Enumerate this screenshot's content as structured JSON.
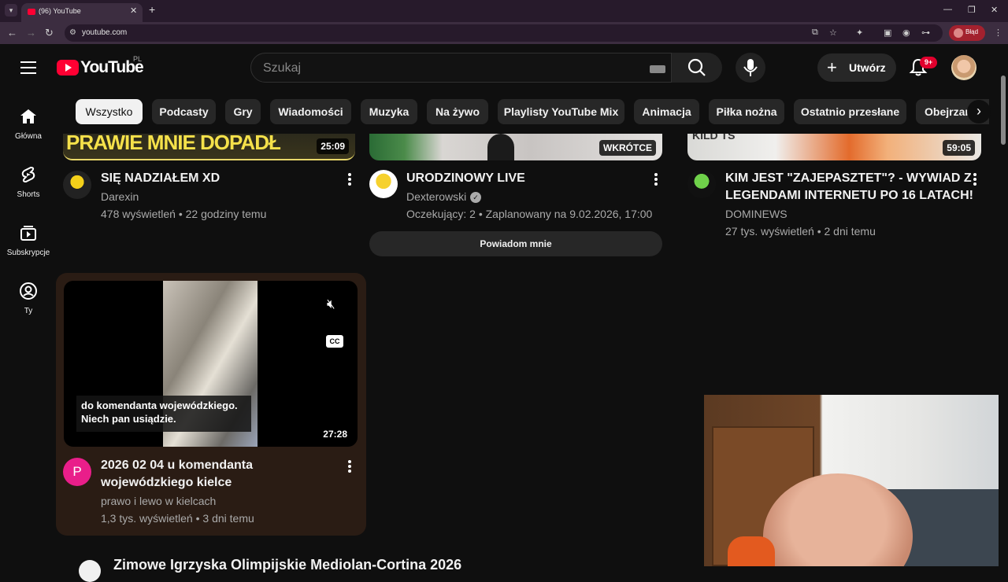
{
  "browser": {
    "tab_title": "(96) YouTube",
    "url": "youtube.com",
    "profile_label": "Błąd"
  },
  "header": {
    "logo_text": "YouTube",
    "country": "PL",
    "search_placeholder": "Szukaj",
    "create_label": "Utwórz",
    "notifications_badge": "9+"
  },
  "sidebar": {
    "items": [
      {
        "label": "Główna",
        "icon": "home-icon"
      },
      {
        "label": "Shorts",
        "icon": "shorts-icon"
      },
      {
        "label": "Subskrypcje",
        "icon": "subscriptions-icon"
      },
      {
        "label": "Ty",
        "icon": "you-icon"
      }
    ]
  },
  "chips": [
    "Wszystko",
    "Podcasty",
    "Gry",
    "Wiadomości",
    "Muzyka",
    "Na żywo",
    "Playlisty YouTube Mix",
    "Animacja",
    "Piłka nożna",
    "Ostatnio przesłane",
    "Obejrzane"
  ],
  "videos": [
    {
      "thumb_text": "PRAWIE MNIE DOPADŁ",
      "duration": "25:09",
      "title": "SIĘ NADZIAŁEM XD",
      "channel": "Darexin",
      "meta": "478 wyświetleń • 22 godziny temu"
    },
    {
      "thumb_badge": "WKRÓTCE",
      "title": "URODZINOWY LIVE",
      "channel": "Dexterowski",
      "meta": "Oczekujący: 2 • Zaplanowany na 9.02.2026, 17:00",
      "notify_label": "Powiadom mnie"
    },
    {
      "thumb_text": "KILD TS",
      "duration": "59:05",
      "title_lines": [
        "KIM JEST \"ZAJEPASZTET\"? - WYWIAD Z",
        "LEGENDAMI INTERNETU PO 16 LATACH!"
      ],
      "channel": "DOMINEWS",
      "meta": "27 tys. wyświetleń • 2 dni temu"
    },
    {
      "caption_lines": [
        "do komendanta wojewódzkiego.",
        "Niech pan usiądzie."
      ],
      "duration": "27:28",
      "cc_label": "CC",
      "channel_initial": "P",
      "title_lines": [
        "2026 02 04 u komendanta",
        "wojewódzkiego kielce"
      ],
      "channel": "prawo i lewo w kielcach",
      "meta": "1,3 tys. wyświetleń • 3 dni temu"
    }
  ],
  "next_section_title": "Zimowe Igrzyska Olimpijskie Mediolan-Cortina 2026",
  "colors": {
    "background": "#0f0f0f",
    "brand_red": "#ff0033",
    "chip_bg": "#272727",
    "hover_card": "#2a1c14"
  }
}
